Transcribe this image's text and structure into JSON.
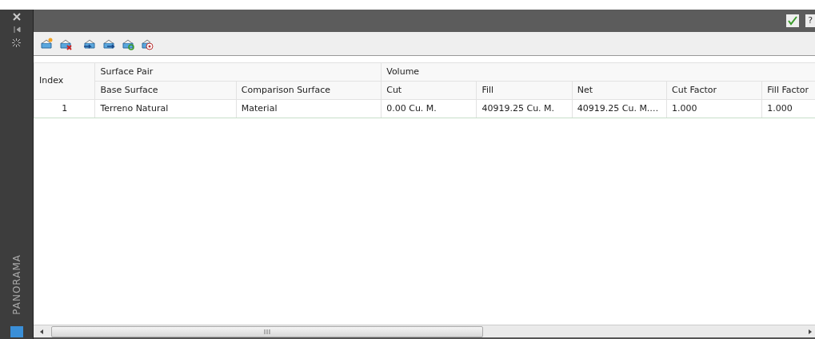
{
  "side_panel": {
    "label": "PANORAMA"
  },
  "table": {
    "index_column": "Index",
    "column_groups": [
      {
        "label": "Surface Pair",
        "columns": [
          "Base Surface",
          "Comparison Surface"
        ]
      },
      {
        "label": "Volume",
        "columns": [
          "Cut",
          "Fill",
          "Net",
          "Cut Factor",
          "Fill Factor"
        ]
      }
    ],
    "rows": [
      {
        "index": "1",
        "cells": [
          "Terreno Natural",
          "Material",
          "0.00 Cu. M.",
          "40919.25 Cu. M.",
          "40919.25 Cu. M.…",
          "1.000",
          "1.000"
        ]
      }
    ]
  },
  "title_bar": {
    "help": "?"
  }
}
